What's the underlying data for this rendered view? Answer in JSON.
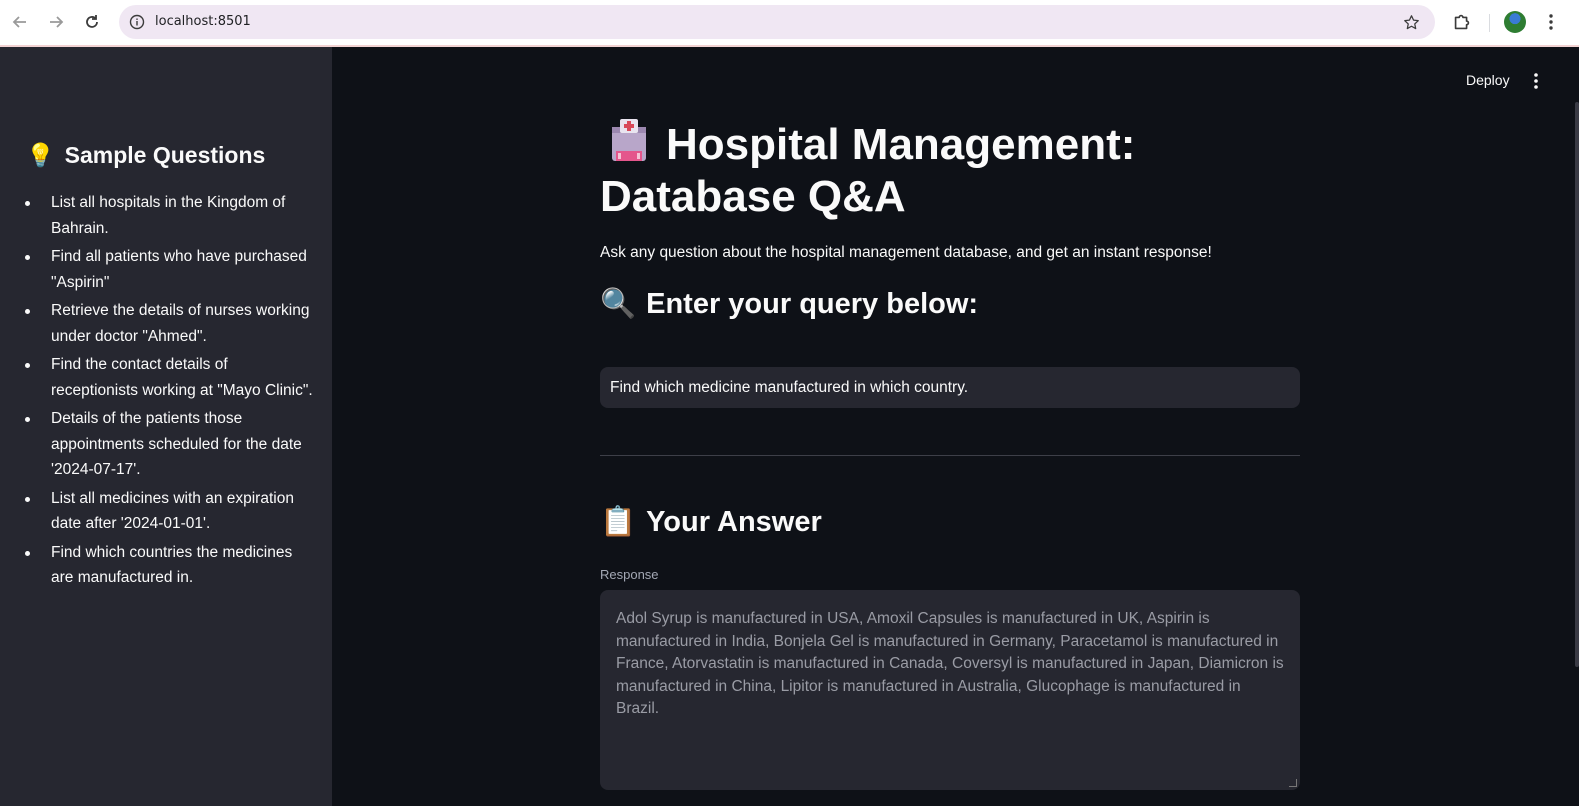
{
  "browser": {
    "url": "localhost:8501"
  },
  "sidebar": {
    "heading_emoji": "💡",
    "heading": "Sample Questions",
    "items": [
      "List all hospitals in the Kingdom of Bahrain.",
      "Find all patients who have purchased \"Aspirin\"",
      "Retrieve the details of nurses working under doctor \"Ahmed\".",
      "Find the contact details of receptionists working at \"Mayo Clinic\".",
      "Details of the patients those appointments scheduled for the date '2024-07-17'.",
      "List all medicines with an expiration date after '2024-01-01'.",
      "Find which countries the medicines are manufactured in."
    ]
  },
  "header": {
    "deploy_label": "Deploy"
  },
  "main": {
    "title": "Hospital Management: Database Q&A",
    "subtitle": "Ask any question about the hospital management database, and get an instant response!",
    "query_heading_emoji": "🔍",
    "query_heading": "Enter your query below:",
    "query_value": "Find which medicine manufactured in which country.",
    "answer_heading_emoji": "📋",
    "answer_heading": "Your Answer",
    "response_label": "Response",
    "response_text": "Adol Syrup is manufactured in USA, Amoxil Capsules is manufactured in UK, Aspirin is manufactured in India, Bonjela Gel is manufactured in Germany, Paracetamol is manufactured in France, Atorvastatin is manufactured in Canada, Coversyl is manufactured in Japan, Diamicron is manufactured in China, Lipitor is manufactured in Australia, Glucophage is manufactured in Brazil."
  }
}
